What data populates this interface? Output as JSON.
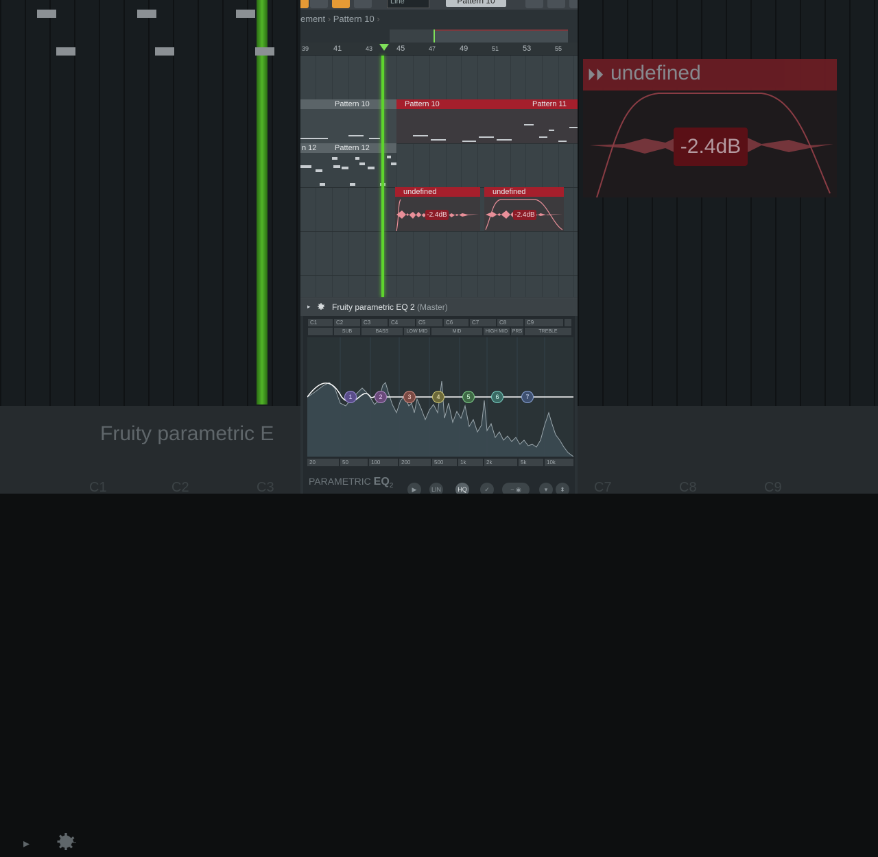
{
  "toolbar": {
    "mode_label": "Line",
    "pattern_selector": "Pattern 10"
  },
  "breadcrumb": {
    "parent": "ement",
    "current": "Pattern 10"
  },
  "ruler": {
    "marks": [
      "39",
      "41",
      "43",
      "45",
      "47",
      "49",
      "51",
      "53",
      "55"
    ]
  },
  "playlist": {
    "clips": [
      {
        "name": "Pattern 10"
      },
      {
        "name": "Pattern 10"
      },
      {
        "name": "Pattern 11"
      },
      {
        "name": "n 12"
      },
      {
        "name": "Pattern 12"
      },
      {
        "name": "undefined"
      },
      {
        "name": "undefined"
      }
    ],
    "audio_gain": "-2.4dB"
  },
  "zoom_overlay": {
    "clip_name": "undefined",
    "gain": "-2.4dB",
    "plugin_title": "Fruity parametric E",
    "keys": [
      "C1",
      "C2",
      "C3",
      "C7",
      "C8",
      "C9"
    ]
  },
  "plugin": {
    "name": "Fruity parametric EQ 2",
    "target": "(Master)",
    "note_labels": [
      "C1",
      "C2",
      "C3",
      "C4",
      "C5",
      "C6",
      "C7",
      "C8",
      "C9"
    ],
    "band_labels": [
      "SUB",
      "BASS",
      "LOW MID",
      "MID",
      "HIGH MID",
      "PRS",
      "TREBLE"
    ],
    "bands": [
      "1",
      "2",
      "3",
      "4",
      "5",
      "6",
      "7"
    ],
    "freq_labels": [
      "20",
      "50",
      "100",
      "200",
      "500",
      "1k",
      "2k",
      "5k",
      "10k"
    ],
    "logo": "PARAMETRIC",
    "logo_bold": "EQ",
    "logo_sub": "2",
    "buttons": {
      "lin": "LIN",
      "hq": "HQ"
    }
  },
  "colors": {
    "accent_orange": "#e69a35",
    "playhead_green": "#5ed42d",
    "clip_red": "#a51f2c"
  }
}
